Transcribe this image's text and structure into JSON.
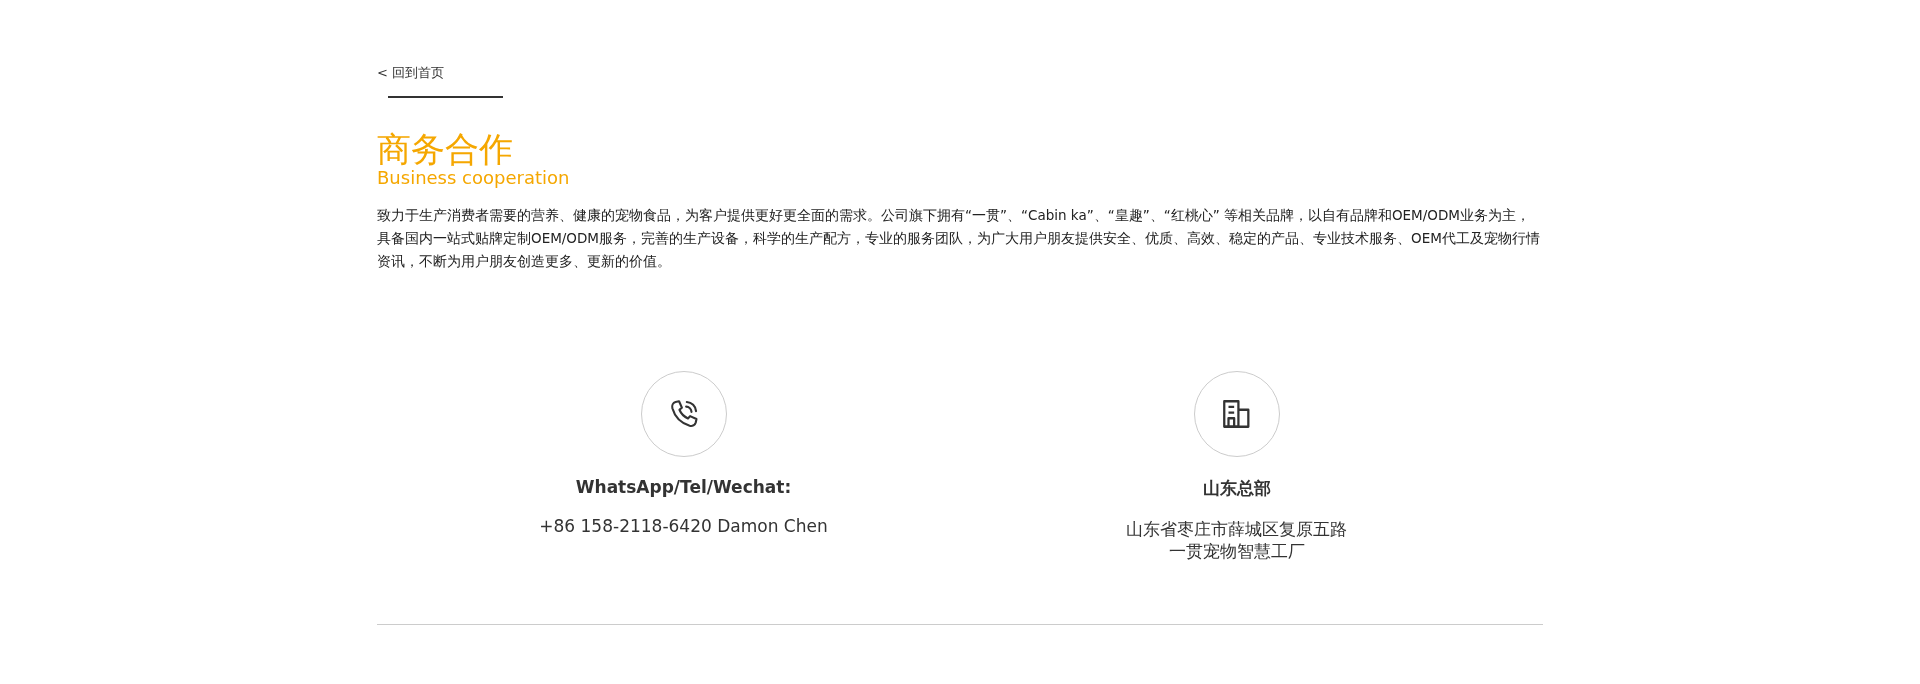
{
  "back_link": {
    "arrow": "<",
    "label": "回到首页"
  },
  "heading": {
    "title": "商务合作",
    "subtitle": "Business cooperation"
  },
  "intro": "致力于生产消费者需要的营养、健康的宠物食品，为客户提供更好更全面的需求。公司旗下拥有“一贯”、“Cabin ka”、“皇趣”、“红桃心” 等相关品牌，以自有品牌和OEM/ODM业务为主，具备国内一站式贴牌定制OEM/ODM服务，完善的生产设备，科学的生产配方，专业的服务团队，为广大用户朋友提供安全、优质、高效、稳定的产品、专业技术服务、OEM代工及宠物行情资讯，不断为用户朋友创造更多、更新的价值。",
  "contacts": [
    {
      "kind": "phone",
      "title": "WhatsApp/Tel/Wechat:",
      "lines": [
        "+86 158-2118-6420 Damon Chen"
      ]
    },
    {
      "kind": "office",
      "title": "山东总部",
      "lines": [
        "山东省枣庄市薛城区复原五路",
        "一贯宠物智慧工厂"
      ]
    }
  ]
}
